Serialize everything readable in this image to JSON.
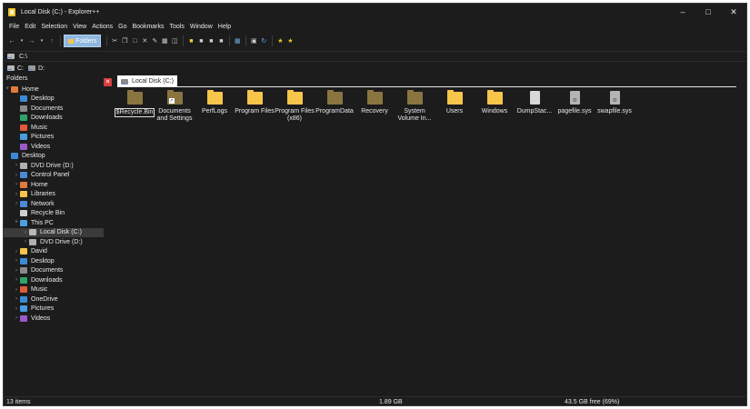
{
  "window": {
    "title": "Local Disk (C:) - Explorer++",
    "controls": [
      "minimize",
      "maximize",
      "close"
    ]
  },
  "menu": [
    "File",
    "Edit",
    "Selection",
    "View",
    "Actions",
    "Go",
    "Bookmarks",
    "Tools",
    "Window",
    "Help"
  ],
  "toolbar": {
    "folders_label": "Folders"
  },
  "address": {
    "value": "C:\\"
  },
  "drives": [
    "C:",
    "D:"
  ],
  "folders_pane": {
    "header": "Folders",
    "items": [
      {
        "label": "Home",
        "icon": "home-icon",
        "level": 0,
        "chevron": "down"
      },
      {
        "label": "Desktop",
        "icon": "desktop-icon",
        "level": 1,
        "chevron": ""
      },
      {
        "label": "Documents",
        "icon": "documents-icon",
        "level": 1,
        "chevron": ""
      },
      {
        "label": "Downloads",
        "icon": "downloads-icon",
        "level": 1,
        "chevron": ""
      },
      {
        "label": "Music",
        "icon": "music-icon",
        "level": 1,
        "chevron": ""
      },
      {
        "label": "Pictures",
        "icon": "pictures-icon",
        "level": 1,
        "chevron": ""
      },
      {
        "label": "Videos",
        "icon": "videos-icon",
        "level": 1,
        "chevron": ""
      },
      {
        "label": "Desktop",
        "icon": "desktop-icon",
        "level": 0,
        "chevron": ""
      },
      {
        "label": "DVD Drive (D:)",
        "icon": "dvd-icon",
        "level": 1,
        "chevron": "right"
      },
      {
        "label": "Control Panel",
        "icon": "control-panel-icon",
        "level": 1,
        "chevron": "right"
      },
      {
        "label": "Home",
        "icon": "home-icon",
        "level": 1,
        "chevron": "right"
      },
      {
        "label": "Libraries",
        "icon": "folder-icon",
        "level": 1,
        "chevron": "right"
      },
      {
        "label": "Network",
        "icon": "network-icon",
        "level": 1,
        "chevron": "right"
      },
      {
        "label": "Recycle Bin",
        "icon": "recycle-bin-icon",
        "level": 1,
        "chevron": ""
      },
      {
        "label": "This PC",
        "icon": "pc-icon",
        "level": 1,
        "chevron": "down"
      },
      {
        "label": "Local Disk (C:)",
        "icon": "drive-icon",
        "level": 2,
        "chevron": "right",
        "selected": true
      },
      {
        "label": "DVD Drive (D:)",
        "icon": "dvd-icon",
        "level": 2,
        "chevron": "right"
      },
      {
        "label": "David",
        "icon": "folder-icon",
        "level": 1,
        "chevron": "right"
      },
      {
        "label": "Desktop",
        "icon": "desktop-icon",
        "level": 1,
        "chevron": "right"
      },
      {
        "label": "Documents",
        "icon": "documents-icon",
        "level": 1,
        "chevron": "right"
      },
      {
        "label": "Downloads",
        "icon": "downloads-icon",
        "level": 1,
        "chevron": "right"
      },
      {
        "label": "Music",
        "icon": "music-icon",
        "level": 1,
        "chevron": "right"
      },
      {
        "label": "OneDrive",
        "icon": "onedrive-icon",
        "level": 1,
        "chevron": "right"
      },
      {
        "label": "Pictures",
        "icon": "pictures-icon",
        "level": 1,
        "chevron": "right"
      },
      {
        "label": "Videos",
        "icon": "videos-icon",
        "level": 1,
        "chevron": "right"
      }
    ]
  },
  "tab": {
    "label": "Local Disk (C:)"
  },
  "files": [
    {
      "name": "$Recycle.Bin",
      "kind": "folder-dim",
      "focused": true
    },
    {
      "name": "Documents and Settings",
      "kind": "folder-dim",
      "shortcut": true
    },
    {
      "name": "PerfLogs",
      "kind": "folder"
    },
    {
      "name": "Program Files",
      "kind": "folder"
    },
    {
      "name": "Program Files (x86)",
      "kind": "folder"
    },
    {
      "name": "ProgramData",
      "kind": "folder-dim"
    },
    {
      "name": "Recovery",
      "kind": "folder-dim"
    },
    {
      "name": "System Volume In...",
      "kind": "folder-dim"
    },
    {
      "name": "Users",
      "kind": "folder"
    },
    {
      "name": "Windows",
      "kind": "folder"
    },
    {
      "name": "DumpStac...",
      "kind": "file"
    },
    {
      "name": "pagefile.sys",
      "kind": "sysfile"
    },
    {
      "name": "swapfile.sys",
      "kind": "sysfile"
    }
  ],
  "status": {
    "items": "13 items",
    "size": "1.89 GB",
    "free": "43.5 GB free (69%)"
  },
  "colors": {
    "background": "#1c1c1c",
    "folder": "#f7c54a",
    "folder_dim": "#8a7540",
    "folders_button": "#8fb8e0",
    "close_tab": "#d43b3b"
  }
}
